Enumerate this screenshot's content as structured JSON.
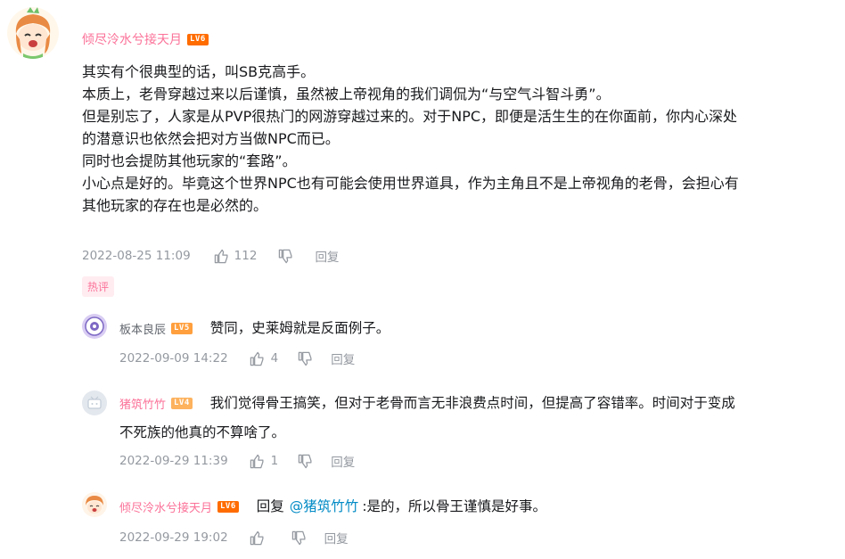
{
  "main_comment": {
    "user": "倾尽泠水兮接天月",
    "level": "LV6",
    "lines": [
      "其实有个很典型的话，叫SB克高手。",
      "本质上，老骨穿越过来以后谨慎，虽然被上帝视角的我们调侃为“与空气斗智斗勇”。",
      "但是别忘了，人家是从PVP很热门的网游穿越过来的。对于NPC，即便是活生生的在你面前，你内心深处",
      "的潜意识也依然会把对方当做NPC而已。",
      "同时也会提防其他玩家的“套路”。",
      "小心点是好的。毕竟这个世界NPC也有可能会使用世界道具，作为主角且不是上帝视角的老骨，会担心有",
      "其他玩家的存在也是必然的。"
    ],
    "time": "2022-08-25 11:09",
    "likes": "112",
    "reply_label": "回复",
    "hot_tag": "热评"
  },
  "replies": [
    {
      "user": "板本良辰",
      "level": "LV5",
      "text": "赞同，史莱姆就是反面例子。",
      "time": "2022-09-09 14:22",
      "likes": "4",
      "reply_label": "回复"
    },
    {
      "user": "猪筑竹竹",
      "level": "LV4",
      "text_line1": "我们觉得骨王搞笑，但对于老骨而言无非浪费点时间，但提高了容错率。时间对于变成",
      "text_line2": "不死族的他真的不算啥了。",
      "time": "2022-09-29 11:39",
      "likes": "1",
      "reply_label": "回复"
    },
    {
      "user": "倾尽泠水兮接天月",
      "level": "LV6",
      "prefix": "回复",
      "mention": "@猪筑竹竹",
      "text": ":是的，所以骨王谨慎是好事。",
      "time": "2022-09-29 19:02",
      "reply_label": "回复"
    }
  ],
  "colors": {
    "username_pink": "#fb7299",
    "username_gray": "#61666d",
    "lv6": "#ff6c00",
    "lv5": "#ff9f3d",
    "lv4": "#fdb25e",
    "mention": "#008ac5",
    "meta_gray": "#9499a0"
  }
}
